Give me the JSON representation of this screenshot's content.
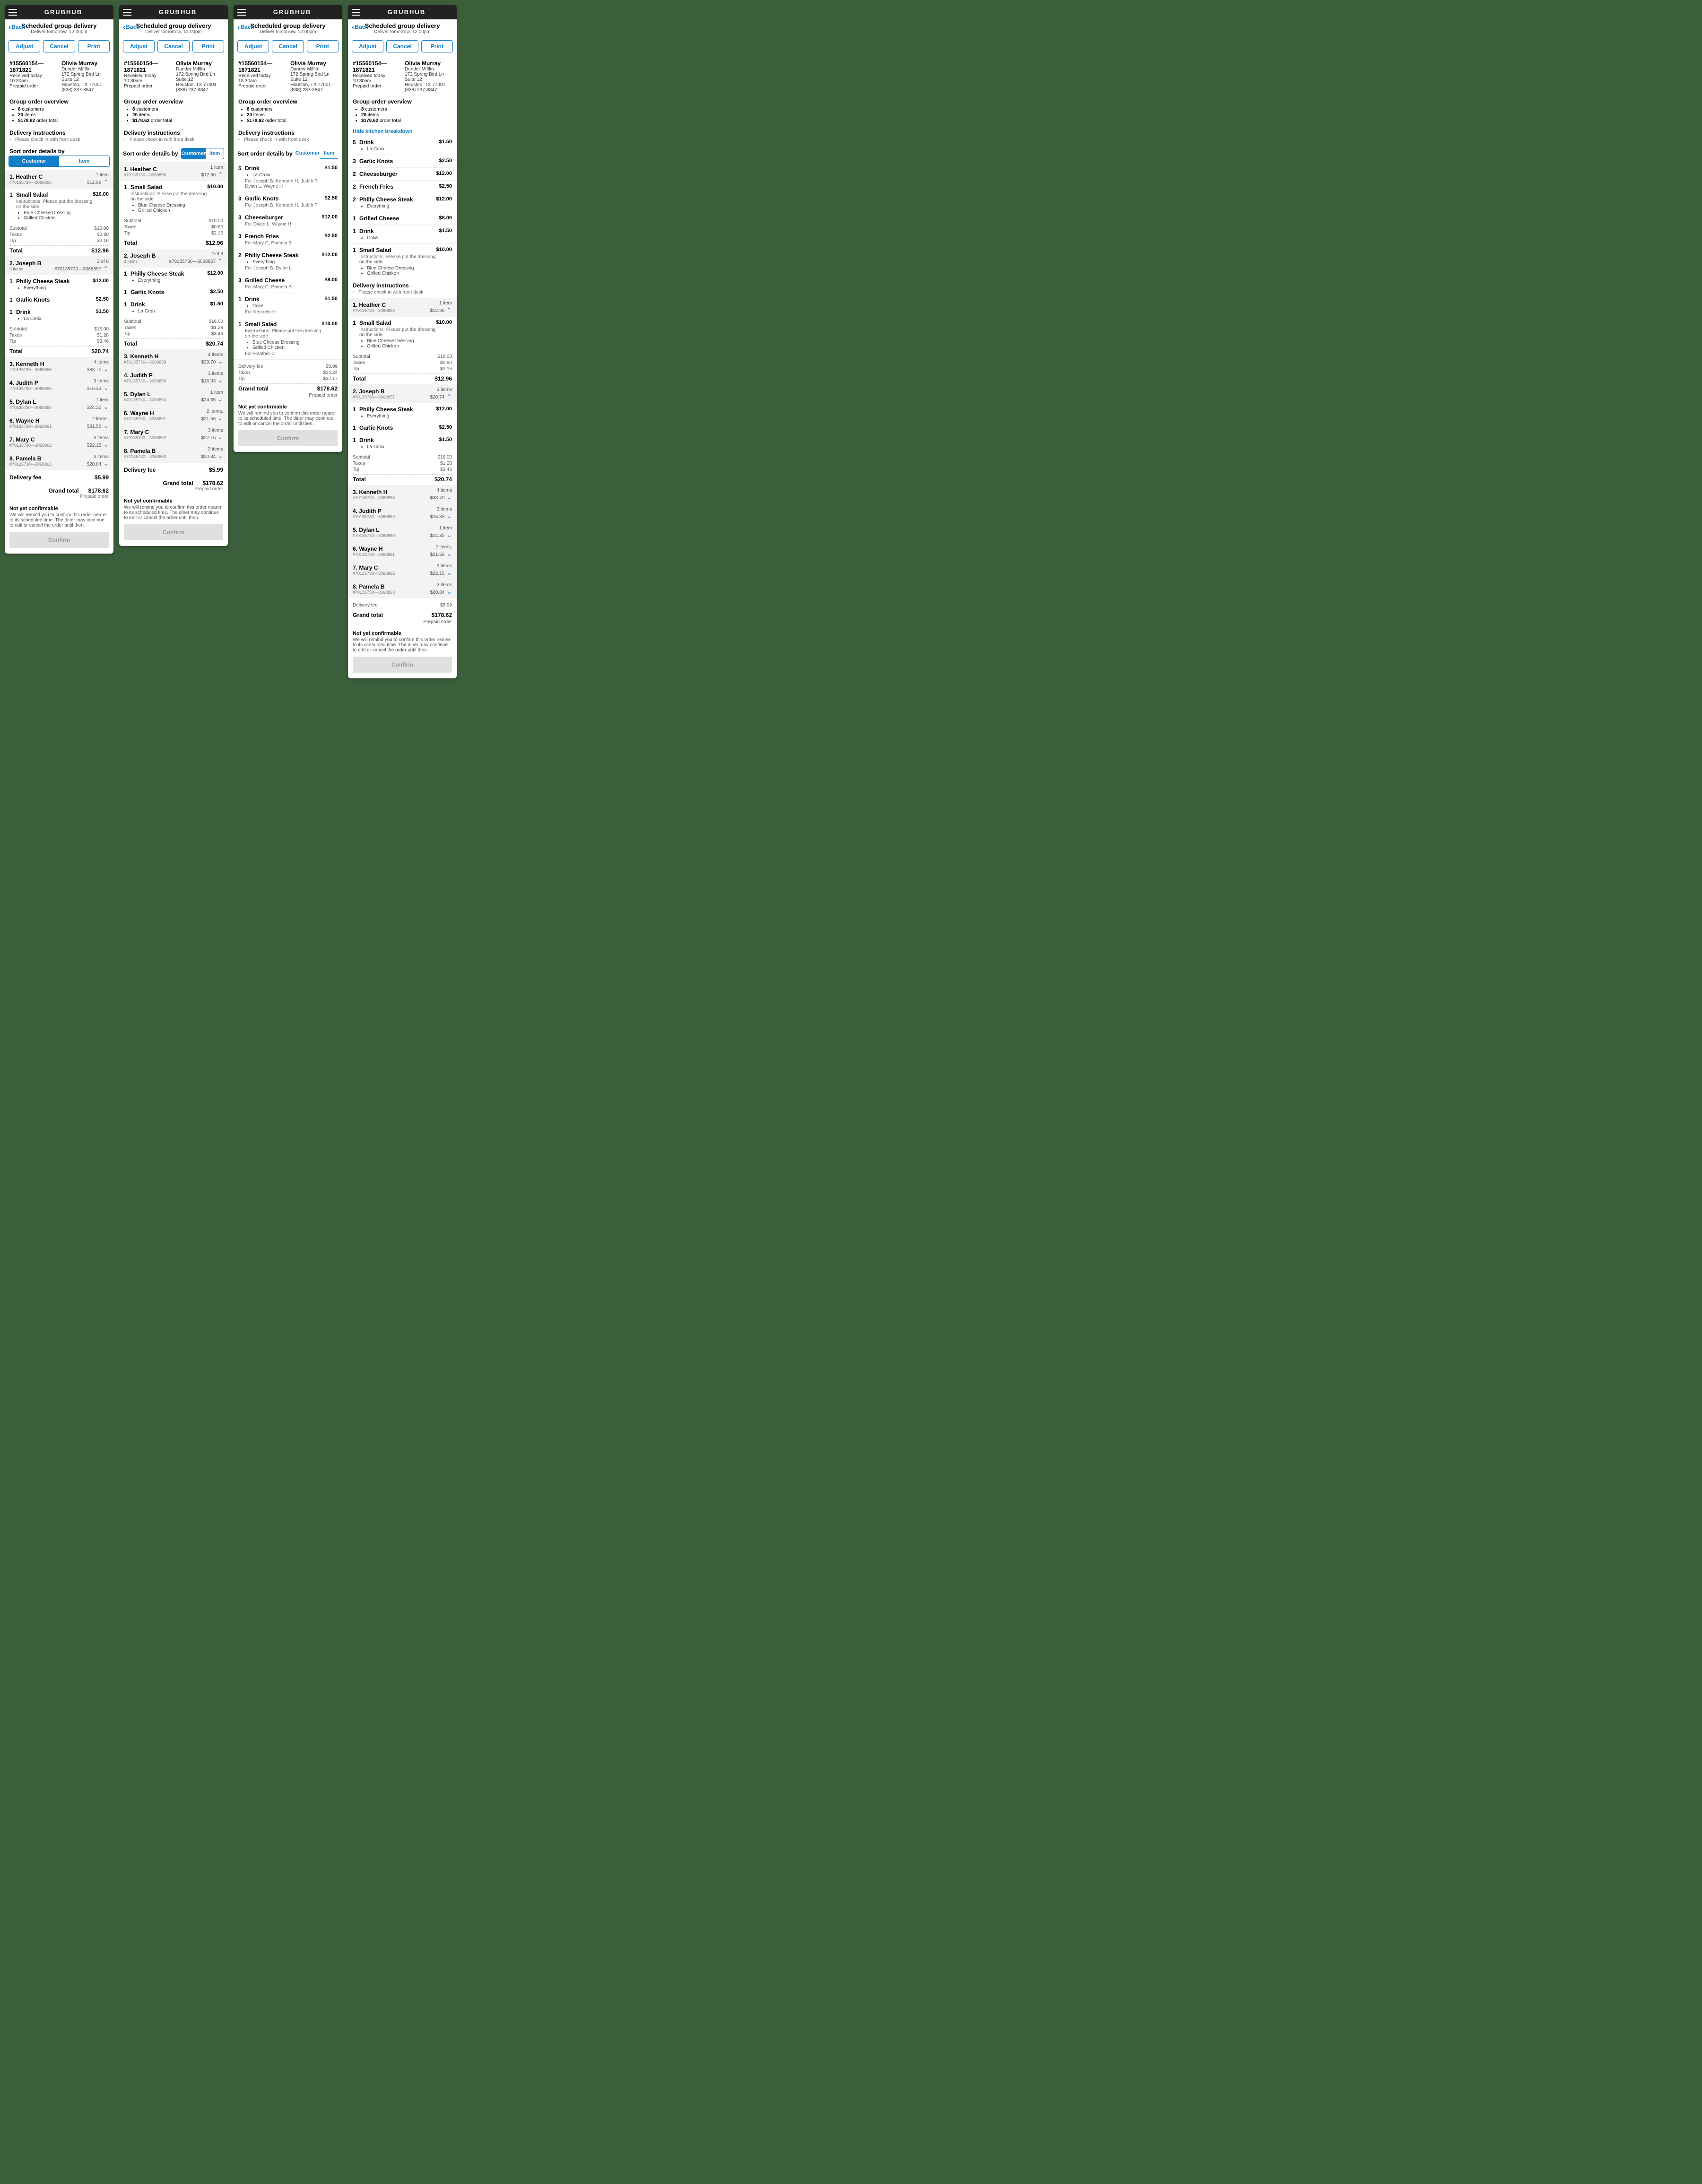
{
  "brand": "GRUBHUB",
  "back": "Back",
  "title": "Scheduled group delivery",
  "subtitle": "Deliver tomorrow, 12:00pm",
  "buttons": {
    "adjust": "Adjust",
    "cancel": "Cancel",
    "print": "Print"
  },
  "order_meta": {
    "id": "#15560154—1871821",
    "received": "Received today 10:30am",
    "prepaid": "Prepaid order"
  },
  "customer_meta": {
    "name": "Olivia Murray",
    "company": "Dunder Mifflin",
    "addr1": "172 Spring Bird Ln",
    "addr2": "Suite 12",
    "city": "Houston, TX 77001",
    "phone": "(838) 237-3847"
  },
  "overview": {
    "title": "Group order overview",
    "customers": "8",
    "items": "20",
    "total": "$178.62",
    "c_lbl": "customers",
    "i_lbl": "items",
    "t_lbl": "order total"
  },
  "delivery": {
    "title": "Delivery instructions",
    "text": "Please check in with front desk"
  },
  "sort": {
    "label": "Sort order details by",
    "customer": "Customer",
    "item": "Item"
  },
  "customers": [
    {
      "n": "1.",
      "name": "Heather C",
      "sub": "#70135730—3068856",
      "count": "1 item",
      "total": "$12.96",
      "lines": [
        {
          "qty": "1",
          "name": "Small Salad",
          "instr": "Instructions: Please put the dressing on the side",
          "mods": [
            "Blue Cheese Dressing",
            "Grilled Chicken"
          ],
          "price": "$10.00"
        }
      ],
      "totals": {
        "sub": "$10.00",
        "tax": "$0.80",
        "tip": "$2.16",
        "tot": "$12.96"
      }
    },
    {
      "n": "2.",
      "name": "Joseph B",
      "sub": "#70135730—3068857",
      "count": "3 items",
      "idx": "2 of 8",
      "total": "$20.74",
      "lines": [
        {
          "qty": "1",
          "name": "Philly Cheese Steak",
          "mods": [
            "Everything"
          ],
          "price": "$12.00"
        },
        {
          "qty": "1",
          "name": "Garlic Knots",
          "price": "$2.50"
        },
        {
          "qty": "1",
          "name": "Drink",
          "mods": [
            "La Croix"
          ],
          "price": "$1.50"
        }
      ],
      "totals": {
        "sub": "$16.00",
        "tax": "$1.28",
        "tip": "$3.46",
        "tot": "$20.74"
      }
    },
    {
      "n": "3.",
      "name": "Kenneth H",
      "sub": "#70135730—3068858",
      "count": "4 items",
      "total": "$33.70"
    },
    {
      "n": "4.",
      "name": "Judith P",
      "sub": "#70135730—3068859",
      "count": "3 items",
      "total": "$16.33"
    },
    {
      "n": "5.",
      "name": "Dylan L",
      "sub": "#70135730—3068860",
      "count": "1 item",
      "total": "$24.35"
    },
    {
      "n": "6.",
      "name": "Wayne H",
      "sub": "#70135730—3068861",
      "count": "2 items,",
      "total": "$21.56"
    },
    {
      "n": "7.",
      "name": "Mary C",
      "sub": "#70135730—3068862",
      "count": "3 items",
      "total": "$22.15"
    },
    {
      "n": "8.",
      "name": "Pamela B",
      "sub": "#70135730—3068863",
      "count": "3 items",
      "total": "$20.84"
    }
  ],
  "delivery_fee": {
    "label": "Delivery fee",
    "amount": "$5.99"
  },
  "grand": {
    "label": "Grand total",
    "amount": "$178.62",
    "pp": "Prepaid order"
  },
  "confirm": {
    "title": "Not yet confirmable",
    "text": "We will remind you to confirm this order nearer to its scheduled time. The diner may continue to edit or cancel the order until then.",
    "btn": "Confirm"
  },
  "item_view": [
    {
      "qty": "5",
      "name": "Drink",
      "mods": [
        "La Croix"
      ],
      "for": "For Joseph B, Kenneth H, Judith P, Dylan L, Wayne H",
      "price": "$1.50"
    },
    {
      "qty": "3",
      "name": "Garlic Knots",
      "for": "For Joseph B, Kenneth H, Judith P",
      "price": "$2.50"
    },
    {
      "qty": "3",
      "name": "Cheeseburger",
      "for": "For Dylan L, Wayne H",
      "price": "$12.00"
    },
    {
      "qty": "3",
      "name": "French Fries",
      "for": "For Mary C, Pamela B",
      "price": "$2.50"
    },
    {
      "qty": "2",
      "name": "Philly Cheese Steak",
      "mods": [
        "Everything"
      ],
      "for": "For Joseph B, Dylan L",
      "price": "$12.00"
    },
    {
      "qty": "3",
      "name": "Grilled Cheese",
      "for": "For Mary C, Pamela B",
      "price": "$8.00"
    },
    {
      "qty": "1",
      "name": "Drink",
      "mods": [
        "Coke"
      ],
      "for": "For Kenneth H",
      "price": "$1.50"
    },
    {
      "qty": "1",
      "name": "Small Salad",
      "instr": "Instructions: Please put the dressing on the side",
      "mods": [
        "Blue Cheese Dressing",
        "Grilled Chicken"
      ],
      "for": "For Heather C",
      "price": "$10.00"
    }
  ],
  "item_totals": {
    "delivery": "$5.99",
    "taxes": "$14.24",
    "tip": "$32.17"
  },
  "kitchen": [
    {
      "qty": "5",
      "name": "Drink",
      "mods": [
        "La Croix"
      ],
      "price": "$1.50"
    },
    {
      "qty": "3",
      "name": "Garlic Knots",
      "price": "$2.50"
    },
    {
      "qty": "2",
      "name": "Cheeseburger",
      "price": "$12.00"
    },
    {
      "qty": "2",
      "name": "French Fries",
      "price": "$2.50"
    },
    {
      "qty": "2",
      "name": "Philly Cheese Steak",
      "mods": [
        "Everything"
      ],
      "price": "$12.00"
    },
    {
      "qty": "1",
      "name": "Grilled Cheese",
      "price": "$8.00"
    },
    {
      "qty": "1",
      "name": "Drink",
      "mods": [
        "Coke"
      ],
      "price": "$1.50"
    },
    {
      "qty": "1",
      "name": "Small Salad",
      "instr": "Instructions: Please put the dressing on the side",
      "mods": [
        "Blue Cheese Dressing",
        "Grilled Chicken"
      ],
      "price": "$10.00"
    }
  ],
  "hide_link": "Hide kitchen breakdown",
  "totals_labels": {
    "sub": "Subtotal",
    "tax": "Taxes",
    "tip": "Tip",
    "tot": "Total"
  }
}
